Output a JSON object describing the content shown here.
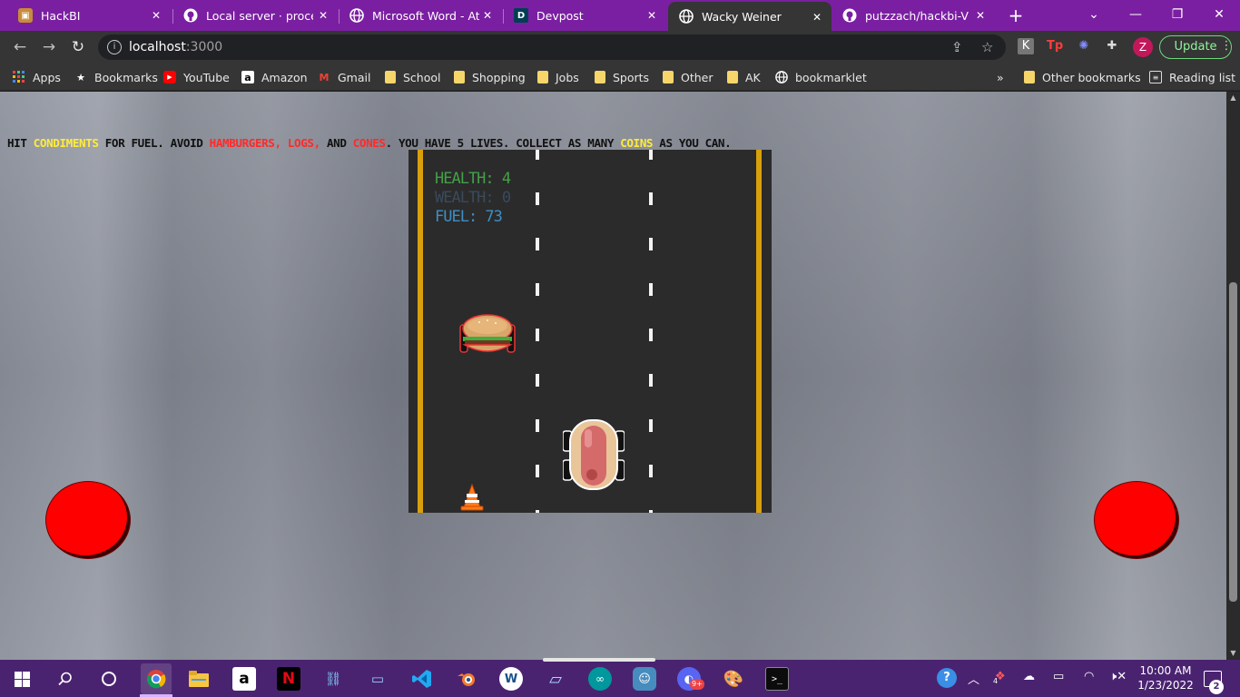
{
  "browser": {
    "tabs": [
      {
        "title": "HackBI",
        "favicon": "hackbi-icon"
      },
      {
        "title": "Local server · processing",
        "favicon": "github-icon"
      },
      {
        "title": "Microsoft Word - Attendance",
        "favicon": "globe-icon"
      },
      {
        "title": "Devpost",
        "favicon": "devpost-icon"
      },
      {
        "title": "Wacky Weiner",
        "favicon": "globe-icon",
        "active": true
      },
      {
        "title": "putzzach/hackbi-V",
        "favicon": "github-icon"
      }
    ],
    "url_host": "localhost",
    "url_port": ":3000",
    "profile_initial": "Z",
    "update_label": "Update",
    "bookmarks": [
      {
        "label": "Apps",
        "icon": "apps-grid-icon"
      },
      {
        "label": "Bookmarks",
        "icon": "star-icon"
      },
      {
        "label": "YouTube",
        "icon": "youtube-icon"
      },
      {
        "label": "Amazon",
        "icon": "amazon-icon"
      },
      {
        "label": "Gmail",
        "icon": "gmail-icon"
      },
      {
        "label": "School",
        "icon": "folder-icon"
      },
      {
        "label": "Shopping",
        "icon": "folder-icon"
      },
      {
        "label": "Jobs",
        "icon": "folder-icon"
      },
      {
        "label": "Sports",
        "icon": "folder-icon"
      },
      {
        "label": "Other",
        "icon": "folder-icon"
      },
      {
        "label": "AK",
        "icon": "folder-icon"
      },
      {
        "label": "bookmarklet",
        "icon": "globe-icon"
      }
    ],
    "more_bookmarks": "»",
    "other_bookmarks": "Other bookmarks",
    "reading_list": "Reading list"
  },
  "game": {
    "instructions": {
      "p1": "Hit ",
      "condiments": "condiments",
      "p2": " for fuel. Avoid ",
      "hazards": "hamburgers, logs,",
      "p3": " and ",
      "cones": "cones",
      "p4": ". You have 5 lives. Collect as many ",
      "coins": "coins",
      "p5": " as you can."
    },
    "health_label": "Health: 4",
    "wealth_label": "Wealth: 0",
    "fuel_label": "Fuel: 73",
    "colors": {
      "road": "#2b2b2b",
      "edge_line": "#d9a00b",
      "joystick": "#ff0000",
      "health": "#43a047",
      "fuel": "#3d8fc4"
    }
  },
  "taskbar": {
    "time": "10:00 AM",
    "date": "1/23/2022",
    "notification_count": "2",
    "discord_badge": "9+",
    "tray_badge": "4"
  }
}
